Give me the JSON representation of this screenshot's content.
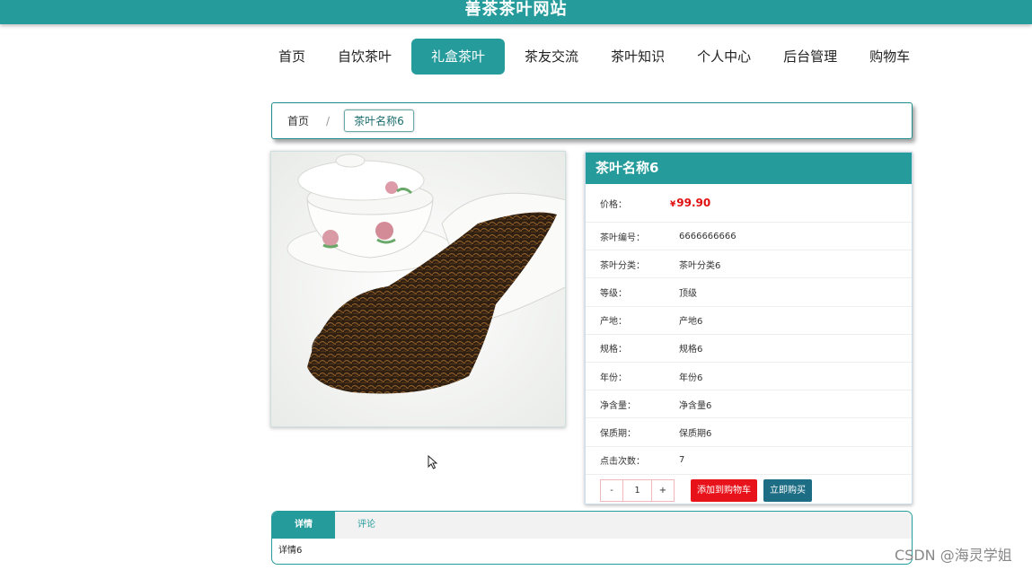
{
  "header": {
    "site_title": "善茶茶叶网站"
  },
  "nav": {
    "items": [
      {
        "label": "首页"
      },
      {
        "label": "自饮茶叶"
      },
      {
        "label": "礼盒茶叶"
      },
      {
        "label": "茶友交流"
      },
      {
        "label": "茶叶知识"
      },
      {
        "label": "个人中心"
      },
      {
        "label": "后台管理"
      },
      {
        "label": "购物车"
      }
    ],
    "active": "礼盒茶叶"
  },
  "breadcrumb": {
    "home": "首页",
    "separator": "/",
    "current": "茶叶名称6"
  },
  "product": {
    "image_alt": "tea-leaves-with-gaiwan-photo",
    "name": "茶叶名称6",
    "price_label": "价格：",
    "currency": "¥",
    "price": "99.90",
    "attributes": [
      {
        "label": "茶叶编号：",
        "value": "6666666666"
      },
      {
        "label": "茶叶分类：",
        "value": "茶叶分类6"
      },
      {
        "label": "等级：",
        "value": "顶级"
      },
      {
        "label": "产地：",
        "value": "产地6"
      },
      {
        "label": "规格：",
        "value": "规格6"
      },
      {
        "label": "年份：",
        "value": "年份6"
      },
      {
        "label": "净含量：",
        "value": "净含量6"
      },
      {
        "label": "保质期：",
        "value": "保质期6"
      },
      {
        "label": "点击次数：",
        "value": "7"
      }
    ],
    "quantity": {
      "minus": "-",
      "value": "1",
      "plus": "+"
    },
    "add_to_cart": "添加到购物车",
    "buy_now": "立即购买"
  },
  "tabs": {
    "items": [
      {
        "label": "详情"
      },
      {
        "label": "评论"
      }
    ],
    "active": "详情",
    "content": "详情6"
  },
  "watermark": "CSDN @海灵学姐",
  "colors": {
    "primary": "#259b9b",
    "price": "#e01010",
    "cart_button": "#e8121a",
    "buy_button": "#1d6e84"
  }
}
